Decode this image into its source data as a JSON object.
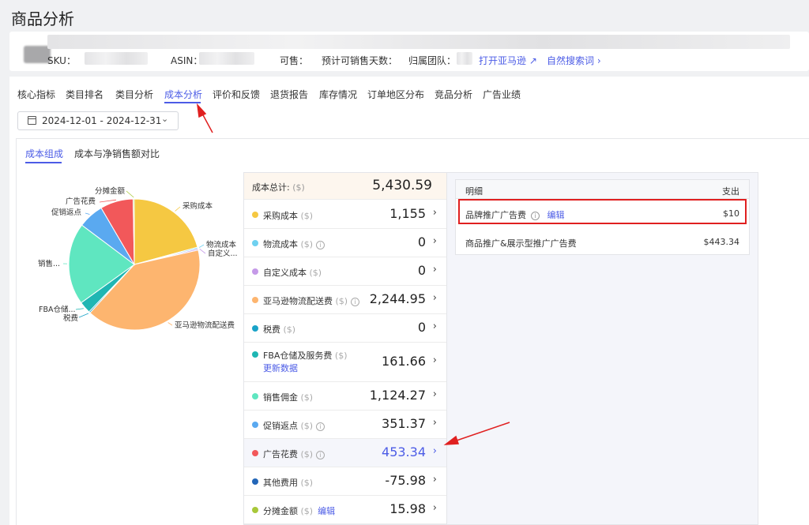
{
  "page": {
    "title": "商品分析"
  },
  "product": {
    "sku_label": "SKU：",
    "asin_label": "ASIN：",
    "sellable_label": "可售：",
    "days_label": "预计可销售天数：",
    "team_label": "归属团队：",
    "open_amazon": "打开亚马逊",
    "organic_search": "自然搜索词"
  },
  "tabs": [
    "核心指标",
    "类目排名",
    "类目分析",
    "成本分析",
    "评价和反馈",
    "退货报告",
    "库存情况",
    "订单地区分布",
    "竞品分析",
    "广告业绩"
  ],
  "date_range": "2024-12-01 - 2024-12-31",
  "sub_tabs": [
    "成本组成",
    "成本与净销售额对比"
  ],
  "pie_labels": {
    "procurement": "采购成本",
    "logistics": "物流成本",
    "custom": "自定义...",
    "amazon_fee": "亚马逊物流配送费",
    "tax": "税费",
    "fba": "FBA仓储...",
    "commission": "销售...",
    "promo": "促销返点",
    "ads": "广告花费",
    "allocation": "分摊金额"
  },
  "cost_table": {
    "total_label": "成本总计:",
    "unit": "($)",
    "total_value": "5,430.59",
    "rows": [
      {
        "label": "采购成本",
        "value": "1,155",
        "color": "#f5c842"
      },
      {
        "label": "物流成本",
        "value": "0",
        "color": "#6fd1f0"
      },
      {
        "label": "自定义成本",
        "value": "0",
        "color": "#c59ae8"
      },
      {
        "label": "亚马逊物流配送费",
        "value": "2,244.95",
        "color": "#fdb56f"
      },
      {
        "label": "税费",
        "value": "0",
        "color": "#1aa3c8"
      },
      {
        "label": "FBA仓储及服务费",
        "value": "161.66",
        "color": "#1fb6b3",
        "link": "更新数据"
      },
      {
        "label": "销售佣金",
        "value": "1,124.27",
        "color": "#5fe6c0"
      },
      {
        "label": "促销返点",
        "value": "351.37",
        "color": "#5aa9f0"
      },
      {
        "label": "广告花费",
        "value": "453.34",
        "color": "#f2585a"
      },
      {
        "label": "其他费用",
        "value": "-75.98",
        "color": "#2366b8"
      },
      {
        "label": "分摊金额",
        "value": "15.98",
        "color": "#a8c83a",
        "link": "编辑"
      }
    ]
  },
  "chart_data": {
    "type": "pie",
    "slices": [
      {
        "name": "采购成本",
        "value": 1155
      },
      {
        "name": "物流成本",
        "value": 0
      },
      {
        "name": "自定义成本",
        "value": 0
      },
      {
        "name": "亚马逊物流配送费",
        "value": 2244.95
      },
      {
        "name": "税费",
        "value": 0
      },
      {
        "name": "FBA仓储及服务费",
        "value": 161.66
      },
      {
        "name": "销售佣金",
        "value": 1124.27
      },
      {
        "name": "促销返点",
        "value": 351.37
      },
      {
        "name": "广告花费",
        "value": 453.34
      },
      {
        "name": "分摊金额",
        "value": 15.98
      }
    ]
  },
  "detail": {
    "col_detail": "明细",
    "col_expense": "支出",
    "rows": [
      {
        "label": "品牌推广广告费",
        "link": "编辑",
        "value": "$10"
      },
      {
        "label": "商品推广&展示型推广广告费",
        "value": "$443.34"
      }
    ]
  }
}
